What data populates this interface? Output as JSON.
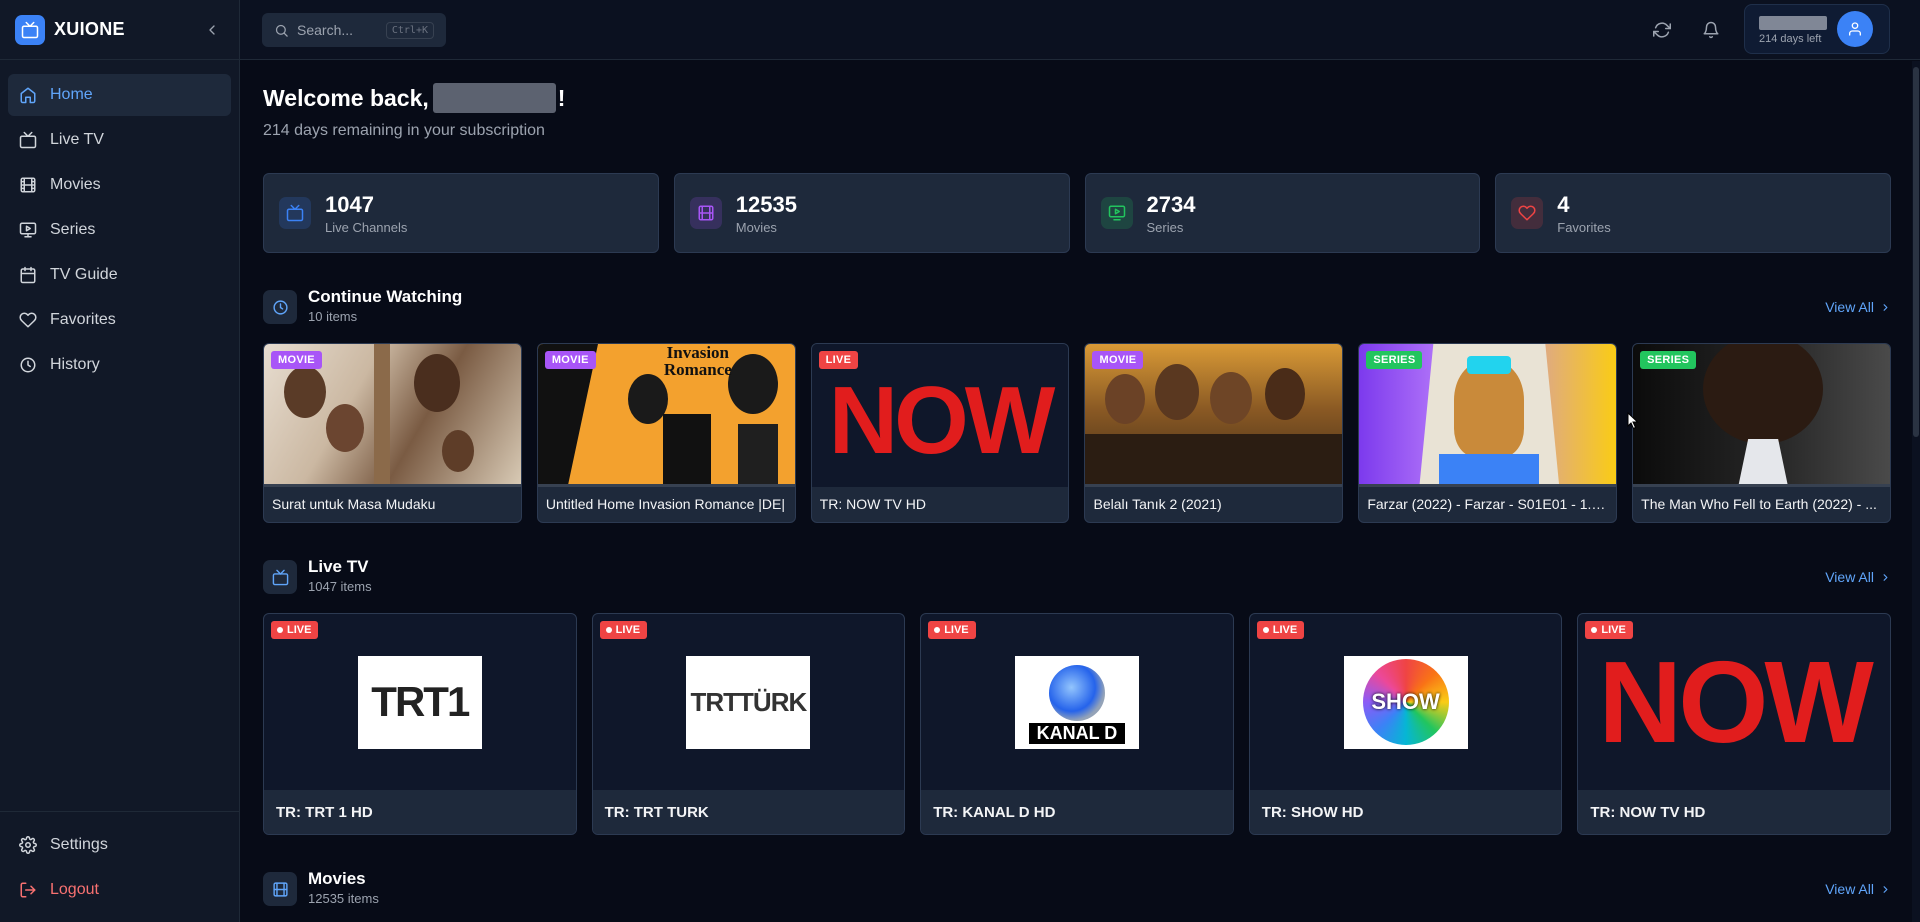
{
  "brand": {
    "name": "XUIONE"
  },
  "sidebar": {
    "items": [
      {
        "label": "Home",
        "icon": "home-icon"
      },
      {
        "label": "Live TV",
        "icon": "tv-icon"
      },
      {
        "label": "Movies",
        "icon": "film-icon"
      },
      {
        "label": "Series",
        "icon": "monitor-play-icon"
      },
      {
        "label": "TV Guide",
        "icon": "calendar-icon"
      },
      {
        "label": "Favorites",
        "icon": "heart-icon"
      },
      {
        "label": "History",
        "icon": "clock-icon"
      }
    ],
    "bottom": [
      {
        "label": "Settings",
        "icon": "gear-icon"
      },
      {
        "label": "Logout",
        "icon": "logout-icon"
      }
    ]
  },
  "topbar": {
    "search_placeholder": "Search...",
    "search_shortcut": "Ctrl+K",
    "user_days": "214 days left"
  },
  "welcome": {
    "prefix": "Welcome back,",
    "suffix": "!",
    "subtitle": "214 days remaining in your subscription"
  },
  "stats": [
    {
      "value": "1047",
      "label": "Live Channels",
      "icon": "tv-icon",
      "color": "#3b82f6"
    },
    {
      "value": "12535",
      "label": "Movies",
      "icon": "film-icon",
      "color": "#a855f7"
    },
    {
      "value": "2734",
      "label": "Series",
      "icon": "monitor-play-icon",
      "color": "#22c55e"
    },
    {
      "value": "4",
      "label": "Favorites",
      "icon": "heart-icon",
      "color": "#ef4444"
    }
  ],
  "sections": {
    "continue": {
      "title": "Continue Watching",
      "count": "10 items",
      "view_all": "View All"
    },
    "live": {
      "title": "Live TV",
      "count": "1047 items",
      "view_all": "View All"
    },
    "movies": {
      "title": "Movies",
      "count": "12535 items",
      "view_all": "View All"
    }
  },
  "continue_watching": [
    {
      "badge": "MOVIE",
      "title": "Surat untuk Masa Mudaku",
      "progress": 0.0
    },
    {
      "badge": "MOVIE",
      "title": "Untitled Home Invasion Romance |DE|",
      "progress": 0.0,
      "poster_text": "Invasion Romance"
    },
    {
      "badge": "LIVE",
      "title": "TR: NOW TV HD",
      "progress": 0.0,
      "poster_text": "NOW"
    },
    {
      "badge": "MOVIE",
      "title": "Belalı Tanık 2 (2021)",
      "progress": 0.0
    },
    {
      "badge": "SERIES",
      "title": "Farzar (2022) - Farzar - S01E01 - 1. B...",
      "progress": 0.0
    },
    {
      "badge": "SERIES",
      "title": "The Man Who Fell to Earth (2022) - ...",
      "progress": 0.0
    }
  ],
  "live_channels": [
    {
      "badge": "LIVE",
      "title": "TR: TRT 1 HD",
      "logo_text": "TRT1"
    },
    {
      "badge": "LIVE",
      "title": "TR: TRT TURK",
      "logo_text": "TRTTÜRK"
    },
    {
      "badge": "LIVE",
      "title": "TR: KANAL D HD",
      "logo_text": "KANAL D"
    },
    {
      "badge": "LIVE",
      "title": "TR: SHOW HD",
      "logo_text": "SHOW"
    },
    {
      "badge": "LIVE",
      "title": "TR: NOW TV HD",
      "logo_text": "NOW"
    }
  ],
  "colors": {
    "accent": "#3b82f6",
    "live": "#ef4444",
    "movie": "#a855f7",
    "series": "#22c55e"
  }
}
